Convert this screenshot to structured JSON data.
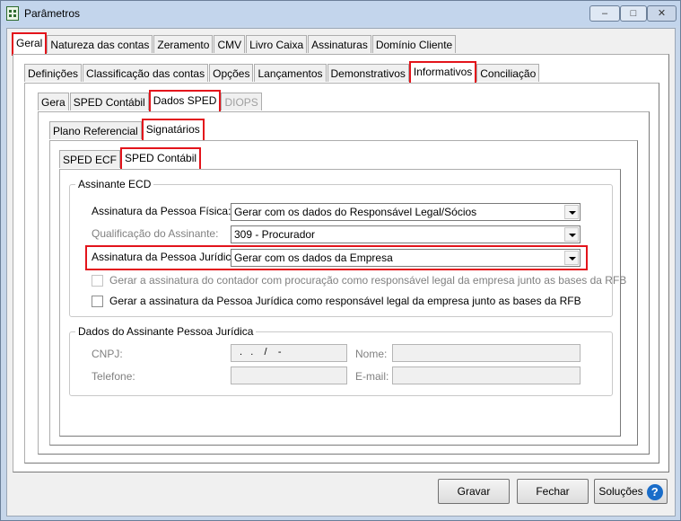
{
  "window": {
    "title": "Parâmetros",
    "minimize": "–",
    "maximize": "□",
    "close": "✕"
  },
  "tabs_main": [
    "Geral",
    "Natureza das contas",
    "Zeramento",
    "CMV",
    "Livro Caixa",
    "Assinaturas",
    "Domínio Cliente"
  ],
  "tabs_level2": [
    "Definições",
    "Classificação das contas",
    "Opções",
    "Lançamentos",
    "Demonstrativos",
    "Informativos",
    "Conciliação"
  ],
  "tabs_level3": [
    "Gera",
    "SPED Contábil",
    "Dados SPED",
    "DIOPS"
  ],
  "tabs_level4": [
    "Plano Referencial",
    "Signatários"
  ],
  "tabs_level5": [
    "SPED ECF",
    "SPED Contábil"
  ],
  "assinante_ecd": {
    "group_label": "Assinante ECD",
    "pf_label": "Assinatura da Pessoa Física:",
    "pf_value": "Gerar com os dados do Responsável Legal/Sócios",
    "qual_label": "Qualificação do Assinante:",
    "qual_value": "309 - Procurador",
    "pj_label": "Assinatura da Pessoa Jurídica:",
    "pj_value": "Gerar com os dados da Empresa",
    "chk1_label": "Gerar a assinatura do contador com procuração como responsável legal da empresa junto as bases da RFB",
    "chk2_label": "Gerar a assinatura da Pessoa Jurídica como responsável legal da empresa junto as bases da RFB"
  },
  "dados_assinante_pj": {
    "group_label": "Dados do Assinante Pessoa Jurídica",
    "cnpj_label": "CNPJ:",
    "cnpj_value": " .   .    /    -",
    "nome_label": "Nome:",
    "telefone_label": "Telefone:",
    "email_label": "E-mail:"
  },
  "buttons": {
    "gravar": "Gravar",
    "fechar": "Fechar",
    "solucoes": "Soluções",
    "help_icon": "?"
  }
}
